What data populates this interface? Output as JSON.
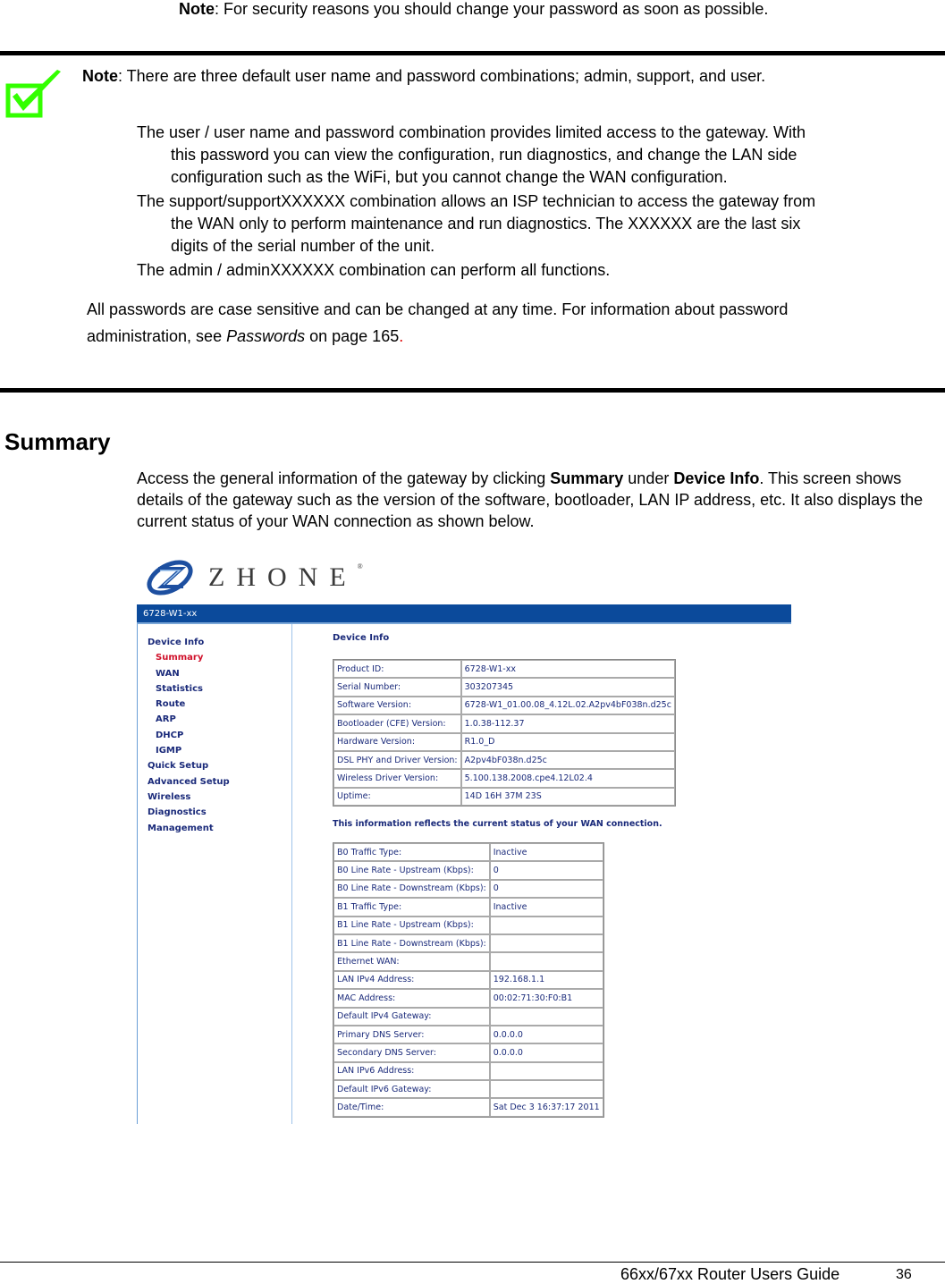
{
  "top_note": {
    "label": "Note",
    "text": ": For security reasons you should change your password as soon as possible."
  },
  "note_box": {
    "icon": "green-checkbox-icon",
    "label": "Note",
    "text": ":  There are three default user name and password combinations; admin, support, and user.",
    "items": [
      {
        "first": "The user / user name and password combination provides limited access to the gateway. With",
        "rest": [
          "this password you can view the configuration, run diagnostics, and change the LAN side",
          "configuration such as the WiFi, but you cannot change the WAN configuration."
        ]
      },
      {
        "first": "The support/supportXXXXXX combination allows an ISP technician to access the gateway from",
        "rest": [
          "the WAN only to perform maintenance and run diagnostics. The XXXXXX are the last six",
          "digits of the serial number of the unit."
        ]
      },
      {
        "first": "The admin / adminXXXXXX combination can perform all functions.",
        "rest": []
      }
    ],
    "passwords_line1": "All passwords are case sensitive and can be changed at any time. For information about password",
    "passwords_line2_pre": "administration, see ",
    "passwords_link": "Passwords",
    "passwords_line2_post": " on page 165",
    "passwords_dot": "."
  },
  "summary": {
    "heading": "Summary",
    "p_pre": "Access the general information of the gateway by clicking ",
    "p_b1": "Summary",
    "p_mid": " under ",
    "p_b2": "Device Info",
    "p_post": ". This screen shows details of the gateway such as the version of the software, bootloader, LAN IP address, etc. It also displays the current status of your WAN connection as shown below."
  },
  "router": {
    "logo_text": "ZHONE",
    "logo_reg": "®",
    "title": "6728-W1-xx",
    "nav": [
      {
        "label": "Device Info",
        "sub": false,
        "active": false
      },
      {
        "label": "Summary",
        "sub": true,
        "active": true
      },
      {
        "label": "WAN",
        "sub": true,
        "active": false
      },
      {
        "label": "Statistics",
        "sub": true,
        "active": false
      },
      {
        "label": "Route",
        "sub": true,
        "active": false
      },
      {
        "label": "ARP",
        "sub": true,
        "active": false
      },
      {
        "label": "DHCP",
        "sub": true,
        "active": false
      },
      {
        "label": "IGMP",
        "sub": true,
        "active": false
      },
      {
        "label": "Quick Setup",
        "sub": false,
        "active": false
      },
      {
        "label": "Advanced Setup",
        "sub": false,
        "active": false
      },
      {
        "label": "Wireless",
        "sub": false,
        "active": false
      },
      {
        "label": "Diagnostics",
        "sub": false,
        "active": false
      },
      {
        "label": "Management",
        "sub": false,
        "active": false
      }
    ],
    "device_info_heading": "Device Info",
    "device_info": [
      [
        "Product ID:",
        "6728-W1-xx"
      ],
      [
        "Serial Number:",
        "303207345"
      ],
      [
        "Software Version:",
        "6728-W1_01.00.08_4.12L.02.A2pv4bF038n.d25c"
      ],
      [
        "Bootloader (CFE) Version:",
        "1.0.38-112.37"
      ],
      [
        "Hardware Version:",
        "R1.0_D"
      ],
      [
        "DSL PHY and Driver Version:",
        "A2pv4bF038n.d25c"
      ],
      [
        "Wireless Driver Version:",
        "5.100.138.2008.cpe4.12L02.4"
      ],
      [
        "Uptime:",
        "14D 16H 37M 23S"
      ]
    ],
    "wan_note": "This information reflects the current status of your WAN connection.",
    "wan_status": [
      [
        "B0 Traffic Type:",
        "Inactive"
      ],
      [
        "B0 Line Rate - Upstream (Kbps):",
        "0"
      ],
      [
        "B0 Line Rate - Downstream (Kbps):",
        "0"
      ],
      [
        "B1 Traffic Type:",
        "Inactive"
      ],
      [
        "B1 Line Rate - Upstream (Kbps):",
        ""
      ],
      [
        "B1 Line Rate - Downstream (Kbps):",
        ""
      ],
      [
        "Ethernet WAN:",
        ""
      ],
      [
        "LAN IPv4 Address:",
        "192.168.1.1"
      ],
      [
        "MAC Address:",
        "00:02:71:30:F0:B1"
      ],
      [
        "Default IPv4 Gateway:",
        ""
      ],
      [
        "Primary DNS Server:",
        "0.0.0.0"
      ],
      [
        "Secondary DNS Server:",
        "0.0.0.0"
      ],
      [
        "LAN IPv6 Address:",
        ""
      ],
      [
        "Default IPv6 Gateway:",
        ""
      ],
      [
        "Date/Time:",
        "Sat Dec 3 16:37:17 2011"
      ]
    ]
  },
  "footer": {
    "guide_title": "66xx/67xx Router Users Guide",
    "page_number": "36"
  },
  "colors": {
    "checkmark": "#33ff00",
    "title_bar": "#0b4a9b",
    "nav_text": "#1a2a7a",
    "nav_active": "#d0102a",
    "logo_blue": "#1d4fa0"
  }
}
